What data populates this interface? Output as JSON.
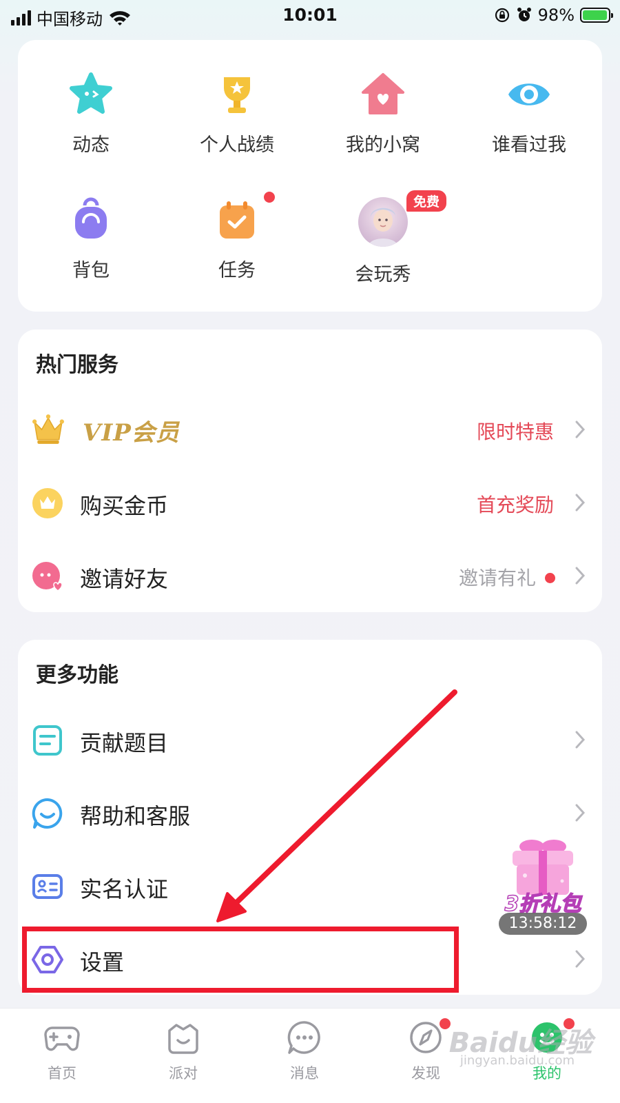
{
  "status_bar": {
    "carrier": "中国移动",
    "time": "10:01",
    "battery": "98%",
    "battery_level": 0.98
  },
  "grid": [
    {
      "label": "动态",
      "icon": "star-face-icon"
    },
    {
      "label": "个人战绩",
      "icon": "trophy-icon"
    },
    {
      "label": "我的小窝",
      "icon": "home-heart-icon"
    },
    {
      "label": "谁看过我",
      "icon": "eye-icon"
    },
    {
      "label": "背包",
      "icon": "backpack-icon"
    },
    {
      "label": "任务",
      "icon": "calendar-check-icon"
    },
    {
      "label": "会玩秀",
      "icon": "avatar-icon",
      "badge": "免费"
    }
  ],
  "hot_services": {
    "title": "热门服务",
    "items": [
      {
        "label": "VIP会员",
        "hint": "限时特惠",
        "icon": "crown-icon"
      },
      {
        "label": "购买金币",
        "hint": "首充奖励",
        "icon": "coin-crown-icon"
      },
      {
        "label": "邀请好友",
        "hint": "邀请有礼",
        "icon": "friend-heart-icon"
      }
    ]
  },
  "more_features": {
    "title": "更多功能",
    "items": [
      {
        "label": "贡献题目",
        "icon": "document-icon"
      },
      {
        "label": "帮助和客服",
        "icon": "chat-smile-icon"
      },
      {
        "label": "实名认证",
        "icon": "id-card-icon"
      },
      {
        "label": "设置",
        "icon": "hexagon-settings-icon"
      }
    ]
  },
  "gift": {
    "title": "3折礼包",
    "timer": "13:58:12"
  },
  "tabs": [
    {
      "label": "首页",
      "icon": "gamepad-icon"
    },
    {
      "label": "派对",
      "icon": "party-face-icon"
    },
    {
      "label": "消息",
      "icon": "message-dots-icon"
    },
    {
      "label": "发现",
      "icon": "compass-icon"
    },
    {
      "label": "我的",
      "icon": "profile-icon",
      "active": true
    }
  ],
  "watermark": {
    "text": "Baidu经验",
    "sub": "jingyan.baidu.com"
  },
  "colors": {
    "accent_green": "#2cc36b",
    "hint_red": "#e44957",
    "annotation_red": "#ee1b2e",
    "badge_red": "#f2424d"
  }
}
